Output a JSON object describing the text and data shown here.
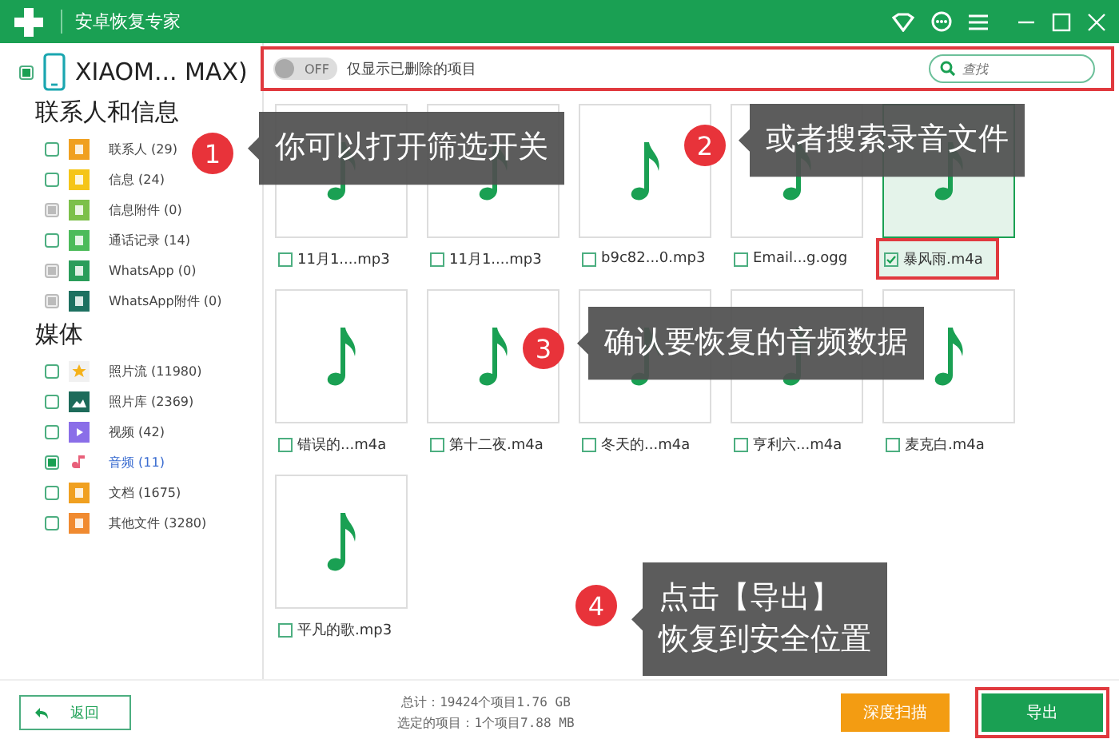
{
  "window": {
    "title": "安卓恢复专家"
  },
  "sidebar": {
    "device": {
      "name": "XIAOM... MAX)",
      "checked": true
    },
    "groups": [
      {
        "title": "联系人和信息",
        "items": [
          {
            "label": "联系人 (29)",
            "kind": "contacts",
            "checked": false,
            "disabled": false,
            "selected": false
          },
          {
            "label": "信息 (24)",
            "kind": "messages",
            "checked": false,
            "disabled": false,
            "selected": false
          },
          {
            "label": "信息附件 (0)",
            "kind": "attachments",
            "checked": false,
            "disabled": true,
            "selected": false
          },
          {
            "label": "通话记录 (14)",
            "kind": "calls",
            "checked": false,
            "disabled": false,
            "selected": false
          },
          {
            "label": "WhatsApp (0)",
            "kind": "whatsapp",
            "checked": false,
            "disabled": true,
            "selected": false
          },
          {
            "label": "WhatsApp附件 (0)",
            "kind": "whatsapp-attachments",
            "checked": false,
            "disabled": true,
            "selected": false
          }
        ]
      },
      {
        "title": "媒体",
        "items": [
          {
            "label": "照片流 (11980)",
            "kind": "photostream",
            "checked": false,
            "disabled": false,
            "selected": false
          },
          {
            "label": "照片库 (2369)",
            "kind": "photos",
            "checked": false,
            "disabled": false,
            "selected": false
          },
          {
            "label": "视频 (42)",
            "kind": "video",
            "checked": false,
            "disabled": false,
            "selected": false
          },
          {
            "label": "音频 (11)",
            "kind": "audio",
            "checked": true,
            "disabled": false,
            "selected": true
          },
          {
            "label": "文档 (1675)",
            "kind": "documents",
            "checked": false,
            "disabled": false,
            "selected": false
          },
          {
            "label": "其他文件 (3280)",
            "kind": "other",
            "checked": false,
            "disabled": false,
            "selected": false
          }
        ]
      }
    ]
  },
  "toolbar": {
    "highlighted": true,
    "toggle": {
      "label": "OFF",
      "on": false
    },
    "filter_label": "仅显示已删除的项目",
    "search": {
      "placeholder": "查找"
    }
  },
  "files": [
    {
      "name": "11月1....mp3",
      "checked": false,
      "highlighted": false
    },
    {
      "name": "11月1....mp3",
      "checked": false,
      "highlighted": false
    },
    {
      "name": "b9c82...0.mp3",
      "checked": false,
      "highlighted": false
    },
    {
      "name": "Email...g.ogg",
      "checked": false,
      "highlighted": false
    },
    {
      "name": "暴风雨.m4a",
      "checked": true,
      "highlighted": true
    },
    {
      "name": "错误的...m4a",
      "checked": false,
      "highlighted": false
    },
    {
      "name": "第十二夜.m4a",
      "checked": false,
      "highlighted": false
    },
    {
      "name": "冬天的...m4a",
      "checked": false,
      "highlighted": false
    },
    {
      "name": "亨利六...m4a",
      "checked": false,
      "highlighted": false
    },
    {
      "name": "麦克白.m4a",
      "checked": false,
      "highlighted": false
    },
    {
      "name": "平凡的歌.mp3",
      "checked": false,
      "highlighted": false
    }
  ],
  "footer": {
    "back_button": "返回",
    "total": "总计：19424个项目1.76 GB",
    "selected": "选定的项目：1个项目7.88 MB",
    "buttons": [
      {
        "label": "深度扫描",
        "kind": "secondary",
        "highlighted": false
      },
      {
        "label": "导出",
        "kind": "primary",
        "highlighted": true
      }
    ]
  },
  "callouts": [
    {
      "number": "1",
      "lines": [
        "你可以打开筛选开关"
      ]
    },
    {
      "number": "2",
      "lines": [
        "或者搜索录音文件"
      ]
    },
    {
      "number": "3",
      "lines": [
        "确认要恢复的音频数据"
      ]
    },
    {
      "number": "4",
      "lines": [
        "点击【导出】",
        "恢复到安全位置"
      ]
    }
  ]
}
